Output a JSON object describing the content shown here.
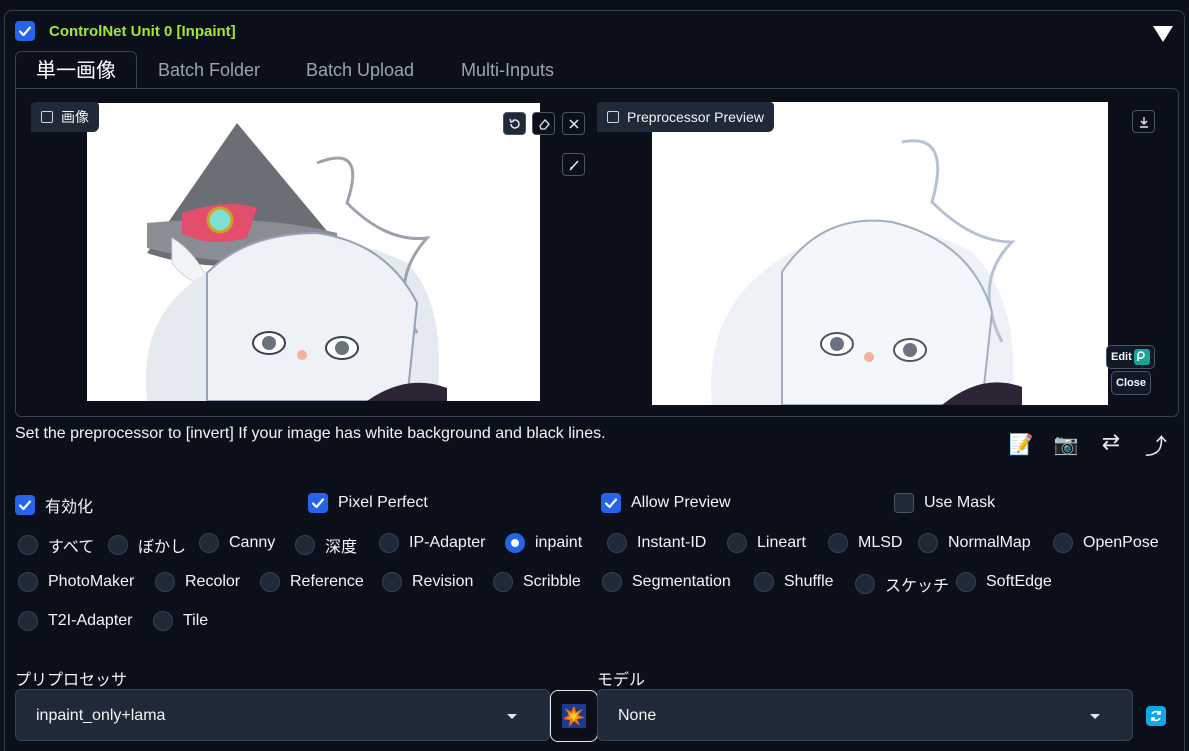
{
  "unit": {
    "title": "ControlNet Unit 0  [Inpaint]",
    "enabled": true
  },
  "tabs": [
    {
      "label": "単一画像",
      "active": true
    },
    {
      "label": "Batch Folder",
      "active": false
    },
    {
      "label": "Batch Upload",
      "active": false
    },
    {
      "label": "Multi-Inputs",
      "active": false
    }
  ],
  "image_panel": {
    "label": "画像",
    "tools": [
      "undo-icon",
      "eraser-icon",
      "close-icon",
      "brush-icon"
    ]
  },
  "preview_panel": {
    "label": "Preprocessor Preview",
    "edit_label": "Edit",
    "close_label": "Close"
  },
  "hint": "Set the preprocessor to [invert] If your image has white background and black lines.",
  "action_icons": [
    "memo-icon",
    "camera-icon",
    "swap-icon",
    "send-icon"
  ],
  "checkboxes": [
    {
      "label": "有効化",
      "checked": true
    },
    {
      "label": "Pixel Perfect",
      "checked": true
    },
    {
      "label": "Allow Preview",
      "checked": true
    },
    {
      "label": "Use Mask",
      "checked": false
    }
  ],
  "control_types": {
    "selected": "inpaint",
    "options": [
      "すべて",
      "ぼかし",
      "Canny",
      "深度",
      "IP-Adapter",
      "inpaint",
      "Instant-ID",
      "Lineart",
      "MLSD",
      "NormalMap",
      "OpenPose",
      "PhotoMaker",
      "Recolor",
      "Reference",
      "Revision",
      "Scribble",
      "Segmentation",
      "Shuffle",
      "スケッチ",
      "SoftEdge",
      "T2I-Adapter",
      "Tile"
    ]
  },
  "preprocessor": {
    "label": "プリプロセッサ",
    "value": "inpaint_only+lama"
  },
  "model": {
    "label": "モデル",
    "value": "None"
  },
  "colors": {
    "accent": "#2563eb",
    "title": "#a3e635",
    "background": "#0b0f19"
  }
}
